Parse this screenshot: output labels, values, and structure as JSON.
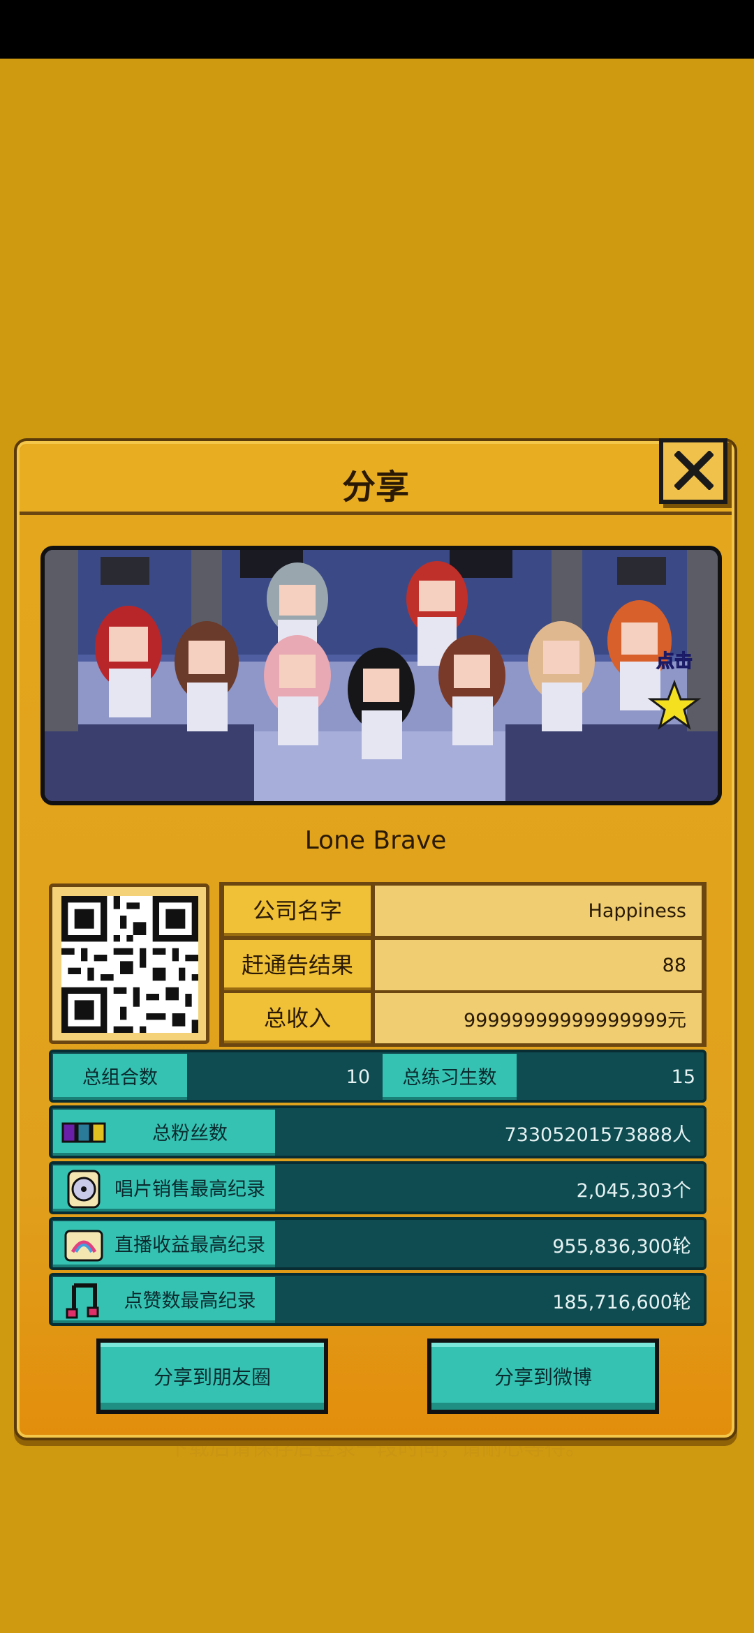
{
  "dialog": {
    "title": "分享"
  },
  "banner": {
    "tap_label": "点击",
    "group_name": "Lone Brave"
  },
  "info": {
    "rows": [
      {
        "label": "公司名字",
        "value": "Happiness"
      },
      {
        "label": "赶通告结果",
        "value": "88"
      },
      {
        "label": "总收入",
        "value": "99999999999999999元"
      }
    ]
  },
  "counts": {
    "groups_label": "总组合数",
    "groups_value": "10",
    "trainees_label": "总练习生数",
    "trainees_value": "15"
  },
  "stats": [
    {
      "label": "总粉丝数",
      "value": "73305201573888人",
      "icon": "fans-icon"
    },
    {
      "label": "唱片销售最高纪录",
      "value": "2,045,303个",
      "icon": "album-icon"
    },
    {
      "label": "直播收益最高纪录",
      "value": "955,836,300轮",
      "icon": "live-stream-icon"
    },
    {
      "label": "点赞数最高纪录",
      "value": "185,716,600轮",
      "icon": "music-note-icon"
    }
  ],
  "buttons": {
    "moments": "分享到朋友圈",
    "weibo": "分享到微博"
  },
  "background_text": "下载后请保存后登录一段时间，请耐心等待。",
  "colors": {
    "background": "#D09A10",
    "panel": "#E4A71C",
    "teal": "#35C2B2",
    "dark_teal": "#0F4C52"
  }
}
